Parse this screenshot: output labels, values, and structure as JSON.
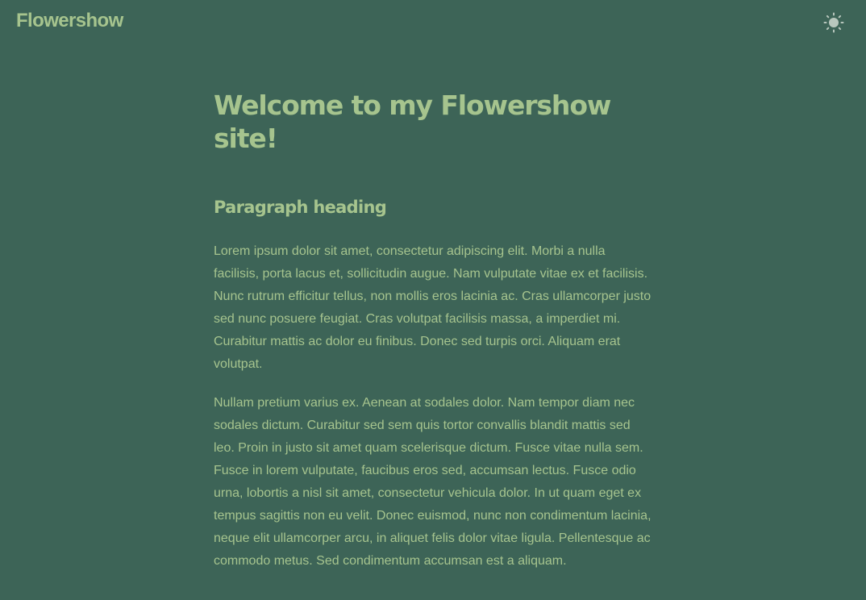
{
  "header": {
    "site_title": "Flowershow",
    "theme_toggle_icon": "sun-icon"
  },
  "main": {
    "title": "Welcome to my Flowershow site!",
    "section_heading": "Paragraph heading",
    "paragraphs": [
      "Lorem ipsum dolor sit amet, consectetur adipiscing elit. Morbi a nulla facilisis, porta lacus et, sollicitudin augue. Nam vulputate vitae ex et facilisis. Nunc rutrum efficitur tellus, non mollis eros lacinia ac. Cras ullamcorper justo sed nunc posuere feugiat. Cras volutpat facilisis massa, a imperdiet mi. Curabitur mattis ac dolor eu finibus. Donec sed turpis orci. Aliquam erat volutpat.",
      "Nullam pretium varius ex. Aenean at sodales dolor. Nam tempor diam nec sodales dictum. Curabitur sed sem quis tortor convallis blandit mattis sed leo. Proin in justo sit amet quam scelerisque dictum. Fusce vitae nulla sem. Fusce in lorem vulputate, faucibus eros sed, accumsan lectus. Fusce odio urna, lobortis a nisl sit amet, consectetur vehicula dolor. In ut quam eget ex tempus sagittis non eu velit. Donec euismod, nunc non condimentum lacinia, neque elit ullamcorper arcu, in aliquet felis dolor vitae ligula. Pellentesque ac commodo metus. Sed condimentum accumsan est a aliquam."
    ]
  },
  "colors": {
    "background": "#3d6457",
    "text": "#a6c48e",
    "icon": "#b8c7bd"
  }
}
